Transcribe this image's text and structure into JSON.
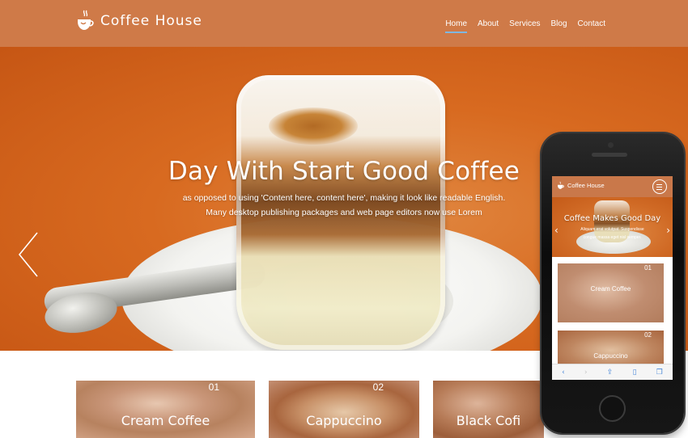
{
  "site": {
    "brand": "Coffee House",
    "nav": [
      "Home",
      "About",
      "Services",
      "Blog",
      "Contact"
    ],
    "active_nav": "Home",
    "colors": {
      "nav_bg": "#cf7a48",
      "active_underline": "#7fb7e0",
      "hero_orange": "#d86a20"
    }
  },
  "hero": {
    "title": "Day With Start Good Coffee",
    "line1": "as opposed to using 'Content here, content here', making it look like readable English.",
    "line2": "Many desktop publishing packages and web page editors now use Lorem",
    "prev_arrow": "chevron-left-icon"
  },
  "cards": [
    {
      "num": "01",
      "label": "Cream Coffee"
    },
    {
      "num": "02",
      "label": "Cappuccino"
    },
    {
      "num": "",
      "label": "Black Cofi"
    }
  ],
  "phone": {
    "brand": "Coffee House",
    "hero_title": "Coffee Makes Good Day",
    "hero_line1": "Aliquam erat volutpat. Suspendisse",
    "hero_line2": "congue massa eget nisl semper.",
    "cards": [
      {
        "num": "01",
        "label": "Cream Coffee"
      },
      {
        "num": "02",
        "label": "Cappuccino"
      }
    ],
    "toolbar_icons": [
      "back-icon",
      "forward-icon",
      "share-icon",
      "bookmarks-icon",
      "tabs-icon"
    ]
  }
}
